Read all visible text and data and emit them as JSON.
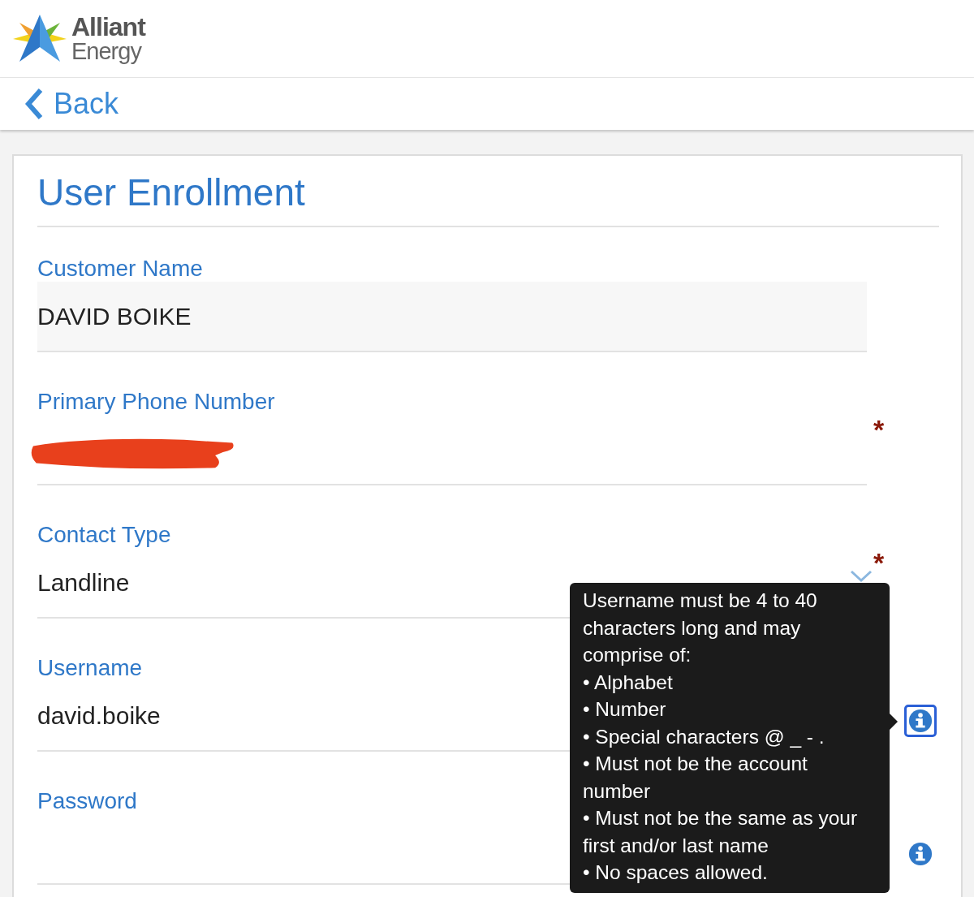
{
  "brand": {
    "name_line1": "Alliant",
    "name_line2": "Energy"
  },
  "back": {
    "label": "Back"
  },
  "form": {
    "title": "User Enrollment",
    "fields": [
      {
        "label": "Customer Name",
        "kind": "readonly",
        "value": "DAVID BOIKE"
      },
      {
        "label": "Primary Phone Number",
        "kind": "text",
        "redacted": true,
        "required_mark": "*"
      },
      {
        "label": "Contact Type",
        "kind": "select",
        "value": "Landline",
        "required_mark": "*"
      },
      {
        "label": "Username",
        "kind": "text",
        "value": "david.boike",
        "info": {
          "focused": true,
          "tooltip": {
            "text": "Username must be 4 to 40 characters long and may comprise of:",
            "items": [
              "• Alphabet",
              "• Number",
              "• Special characters @ _ - .",
              "• Must not be the account number",
              "• Must not be the same as your first and/or last name",
              "• No spaces allowed."
            ]
          }
        }
      },
      {
        "label": "Password",
        "kind": "password",
        "info": {
          "focused": false
        }
      }
    ]
  }
}
